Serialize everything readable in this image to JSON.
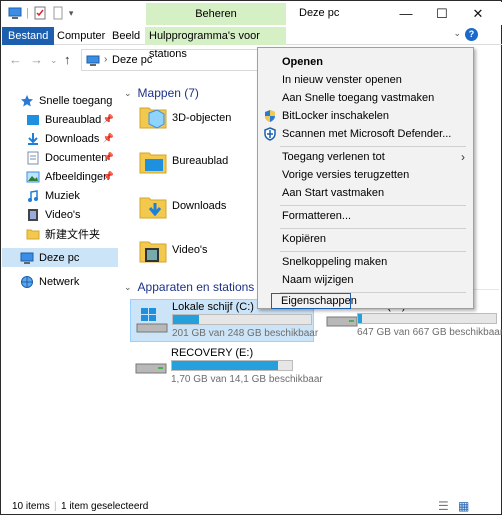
{
  "window": {
    "title": "Deze pc",
    "context_tab": "Beheren",
    "minimize": "—",
    "maximize": "☐",
    "close": "✕"
  },
  "ribbon": {
    "tabs": [
      "Bestand",
      "Computer",
      "Beeld",
      "Hulpprogramma's voor stations"
    ],
    "help": "?"
  },
  "address": {
    "path": "Deze pc"
  },
  "sidebar": {
    "items": [
      {
        "label": "Snelle toegang",
        "icon": "star-icon"
      },
      {
        "label": "Bureaublad",
        "icon": "desktop-folder-icon"
      },
      {
        "label": "Downloads",
        "icon": "download-icon"
      },
      {
        "label": "Documenten",
        "icon": "documents-icon"
      },
      {
        "label": "Afbeeldingen",
        "icon": "pictures-icon"
      },
      {
        "label": "Muziek",
        "icon": "music-icon"
      },
      {
        "label": "Video's",
        "icon": "video-icon"
      },
      {
        "label": "新建文件夹",
        "icon": "folder-icon"
      },
      {
        "label": "Deze pc",
        "icon": "computer-icon"
      },
      {
        "label": "Netwerk",
        "icon": "network-icon"
      }
    ]
  },
  "folders": {
    "heading": "Mappen (7)",
    "items": [
      "3D-objecten",
      "Bureaublad",
      "Downloads",
      "Video's"
    ]
  },
  "drives": {
    "heading": "Apparaten en stations (3)",
    "items": [
      {
        "name": "Lokale schijf (C:)",
        "free": "201 GB van 248 GB beschikbaar",
        "used_fraction": 0.19
      },
      {
        "name": "DATA (D:)",
        "free": "647 GB van 667 GB beschikbaar",
        "used_fraction": 0.03
      },
      {
        "name": "RECOVERY (E:)",
        "free": "1,70 GB van 14,1 GB beschikbaar",
        "used_fraction": 0.88
      }
    ]
  },
  "context_menu": {
    "items": [
      {
        "label": "Openen",
        "bold": true
      },
      {
        "label": "In nieuw venster openen"
      },
      {
        "label": "Aan Snelle toegang vastmaken"
      },
      {
        "label": "BitLocker inschakelen",
        "icon": "shield-icon"
      },
      {
        "label": "Scannen met Microsoft Defender...",
        "icon": "defender-icon"
      },
      {
        "label": "Toegang verlenen tot",
        "submenu": true
      },
      {
        "label": "Vorige versies terugzetten"
      },
      {
        "label": "Aan Start vastmaken"
      },
      {
        "label": "Formatteren..."
      },
      {
        "label": "Kopiëren"
      },
      {
        "label": "Snelkoppeling maken"
      },
      {
        "label": "Naam wijzigen"
      },
      {
        "label": "Eigenschappen"
      }
    ]
  },
  "status": {
    "count": "10 items",
    "selected": "1 item geselecteerd"
  },
  "colors": {
    "accent": "#1b5fae",
    "context_tab": "#d6f0c6",
    "selection": "#cce4f7",
    "drive_fill": "#26a0da",
    "group_heading": "#1e3287"
  }
}
